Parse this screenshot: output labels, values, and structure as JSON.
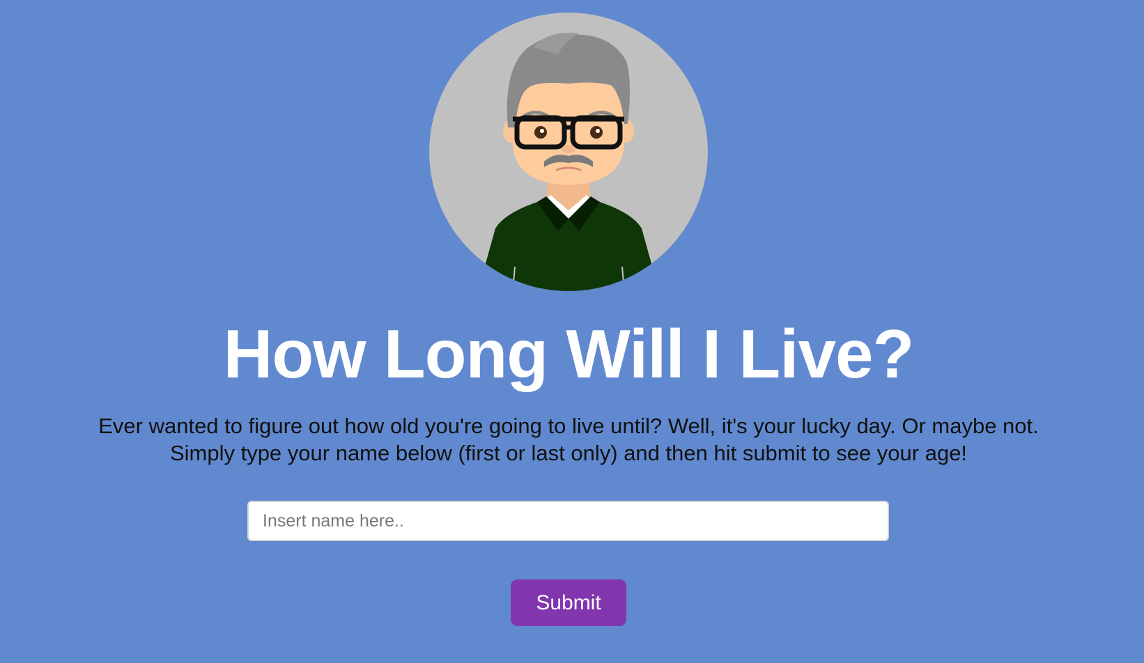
{
  "page": {
    "background_color": "#6189cf",
    "avatar": {
      "icon": "elderly-man-with-glasses-icon",
      "circle_color": "#c0c0c0",
      "sweater_color": "#0f3607"
    },
    "title": "How Long Will I Live?",
    "intro": {
      "line1": "Ever wanted to figure out how old you're going to live until? Well, it's your lucky day. Or maybe not.",
      "line2": "Simply type your name below (first or last only) and then hit submit to see your age!"
    },
    "name_input": {
      "value": "",
      "placeholder": "Insert name here.."
    },
    "submit": {
      "label": "Submit",
      "color": "#8236ae"
    }
  }
}
